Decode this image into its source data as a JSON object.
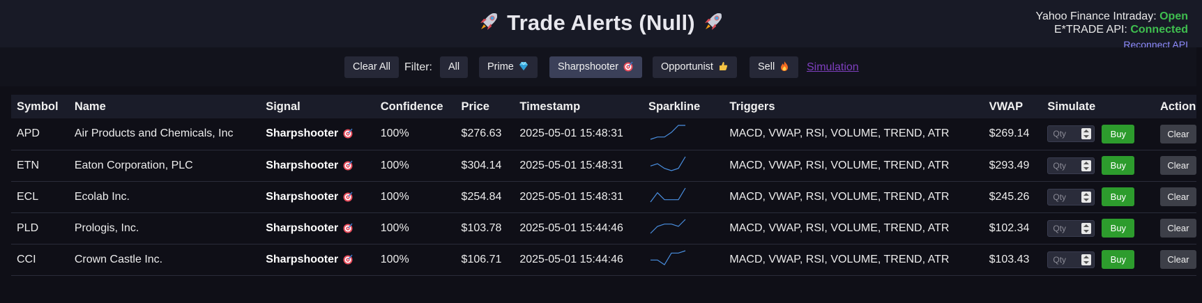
{
  "header": {
    "title": "Trade Alerts (Null)",
    "status": {
      "yahoo_label": "Yahoo Finance Intraday:",
      "yahoo_value": "Open",
      "etrade_label": "E*TRADE API:",
      "etrade_value": "Connected",
      "reconnect_label": "Reconnect API"
    }
  },
  "filters": {
    "clear_all": "Clear All",
    "filter_label": "Filter:",
    "all": "All",
    "prime": "Prime",
    "sharpshooter": "Sharpshooter",
    "opportunist": "Opportunist",
    "sell": "Sell",
    "simulation": "Simulation",
    "active": "Sharpshooter"
  },
  "table": {
    "columns": [
      "Symbol",
      "Name",
      "Signal",
      "Confidence",
      "Price",
      "Timestamp",
      "Sparkline",
      "Triggers",
      "VWAP",
      "Simulate",
      "Action"
    ],
    "qty_placeholder": "Qty",
    "buy_label": "Buy",
    "clear_label": "Clear",
    "rows": [
      {
        "symbol": "APD",
        "name": "Air Products and Chemicals, Inc",
        "signal": "Sharpshooter",
        "confidence": "100%",
        "price": "$276.63",
        "timestamp": "2025-05-01 15:48:31",
        "triggers": "MACD, VWAP, RSI, VOLUME, TREND, ATR",
        "vwap": "$269.14",
        "spark": [
          2,
          3,
          3,
          5,
          8,
          8
        ]
      },
      {
        "symbol": "ETN",
        "name": "Eaton Corporation, PLC",
        "signal": "Sharpshooter",
        "confidence": "100%",
        "price": "$304.14",
        "timestamp": "2025-05-01 15:48:31",
        "triggers": "MACD, VWAP, RSI, VOLUME, TREND, ATR",
        "vwap": "$293.49",
        "spark": [
          5,
          6,
          4,
          3,
          4,
          9
        ]
      },
      {
        "symbol": "ECL",
        "name": "Ecolab Inc.",
        "signal": "Sharpshooter",
        "confidence": "100%",
        "price": "$254.84",
        "timestamp": "2025-05-01 15:48:31",
        "triggers": "MACD, VWAP, RSI, VOLUME, TREND, ATR",
        "vwap": "$245.26",
        "spark": [
          3,
          7,
          4,
          4,
          4,
          9
        ]
      },
      {
        "symbol": "PLD",
        "name": "Prologis, Inc.",
        "signal": "Sharpshooter",
        "confidence": "100%",
        "price": "$103.78",
        "timestamp": "2025-05-01 15:44:46",
        "triggers": "MACD, VWAP, RSI, VOLUME, TREND, ATR",
        "vwap": "$102.34",
        "spark": [
          2,
          5,
          6,
          6,
          5,
          8
        ]
      },
      {
        "symbol": "CCI",
        "name": "Crown Castle Inc.",
        "signal": "Sharpshooter",
        "confidence": "100%",
        "price": "$106.71",
        "timestamp": "2025-05-01 15:44:46",
        "triggers": "MACD, VWAP, RSI, VOLUME, TREND, ATR",
        "vwap": "$103.43",
        "spark": [
          3,
          3,
          1,
          6,
          6,
          7
        ]
      }
    ]
  },
  "colors": {
    "accent_green": "#3fbf4f",
    "buy_green": "#2d9c2d",
    "sparkline": "#4a90e2",
    "link": "#8f8cff",
    "simulation_link": "#7e3fbf"
  },
  "icons": {
    "title": "rocket-icon",
    "prime": "gem-icon",
    "sharpshooter": "target-icon",
    "opportunist": "thumbs-up-icon",
    "sell": "fire-icon"
  }
}
